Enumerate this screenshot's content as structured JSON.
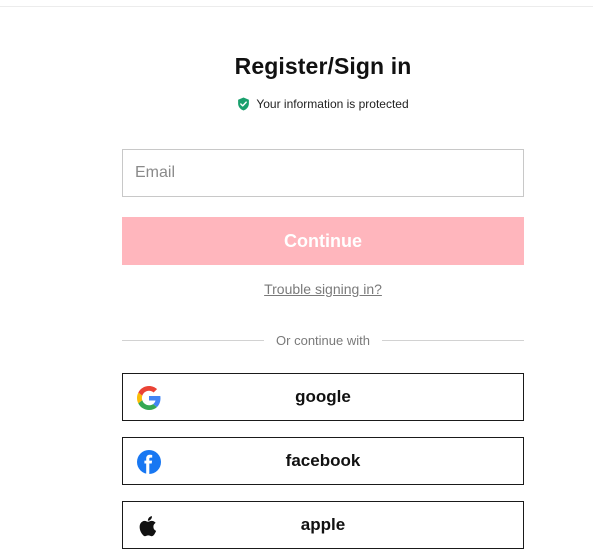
{
  "header": {
    "title": "Register/Sign in",
    "protected_text": "Your information is protected",
    "protected_icon": "shield-check-icon"
  },
  "form": {
    "email_placeholder": "Email",
    "email_value": "",
    "continue_label": "Continue",
    "trouble_link": "Trouble signing in?"
  },
  "divider": {
    "text": "Or continue with"
  },
  "social": [
    {
      "label": "google",
      "icon": "google-icon"
    },
    {
      "label": "facebook",
      "icon": "facebook-icon"
    },
    {
      "label": "apple",
      "icon": "apple-icon"
    }
  ],
  "colors": {
    "continue_disabled_bg": "#ffb6bd",
    "shield_green": "#1aa06d",
    "facebook_blue": "#1877f2"
  }
}
